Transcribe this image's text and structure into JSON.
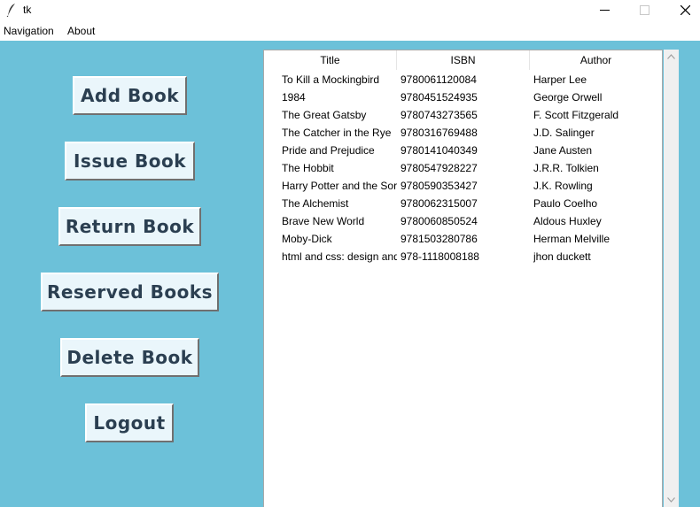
{
  "window": {
    "title": "tk"
  },
  "menu": {
    "items": [
      "Navigation",
      "About"
    ]
  },
  "sidebar": {
    "buttons": [
      "Add Book",
      "Issue Book",
      "Return Book",
      "Reserved Books",
      "Delete Book",
      "Logout"
    ]
  },
  "table": {
    "columns": [
      "Title",
      "ISBN",
      "Author"
    ],
    "rows": [
      [
        "To Kill a Mockingbird",
        "9780061120084",
        "Harper Lee"
      ],
      [
        "1984",
        "9780451524935",
        "George Orwell"
      ],
      [
        "The Great Gatsby",
        "9780743273565",
        "F. Scott Fitzgerald"
      ],
      [
        "The Catcher in the Rye",
        "9780316769488",
        "J.D. Salinger"
      ],
      [
        "Pride and Prejudice",
        "9780141040349",
        "Jane Austen"
      ],
      [
        "The Hobbit",
        "9780547928227",
        "J.R.R. Tolkien"
      ],
      [
        "Harry Potter and the Sorc",
        "9780590353427",
        "J.K. Rowling"
      ],
      [
        "The Alchemist",
        "9780062315007",
        "Paulo Coelho"
      ],
      [
        "Brave New World",
        "9780060850524",
        "Aldous Huxley"
      ],
      [
        "Moby-Dick",
        "9781503280786",
        "Herman Melville"
      ],
      [
        "html and css: design and",
        "978-1118008188",
        "jhon duckett"
      ]
    ]
  },
  "colors": {
    "background": "#6cc1d9",
    "button_bg": "#eaf6fb",
    "button_text": "#2b3f51"
  },
  "icons": {
    "app": "feather-icon",
    "minimize": "minimize-icon",
    "maximize": "maximize-icon",
    "close": "close-icon",
    "scroll_up": "chevron-up-icon",
    "scroll_down": "chevron-down-icon"
  }
}
